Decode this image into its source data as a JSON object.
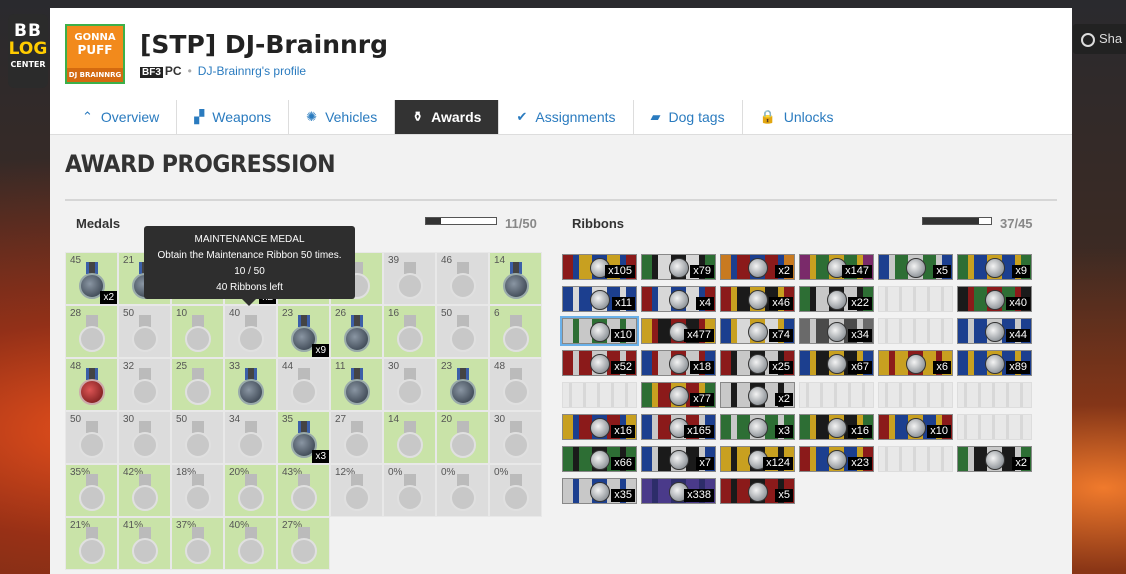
{
  "site_badge": {
    "line1": "BB",
    "line2": "LOG",
    "line3": "CENTER"
  },
  "share_label": "Sha",
  "profile": {
    "avatar": {
      "line1": "GONNA",
      "line2": "PUFF",
      "line3": "DJ BRAINNRG"
    },
    "name": "[STP] DJ-Brainnrg",
    "game_tag": "BF3",
    "platform": "PC",
    "profile_link": "DJ-Brainnrg's profile"
  },
  "tabs": [
    {
      "label": "Overview",
      "icon": "chevron-up-icon",
      "glyph": "⌃"
    },
    {
      "label": "Weapons",
      "icon": "gun-icon",
      "glyph": "▞"
    },
    {
      "label": "Vehicles",
      "icon": "gear-icon",
      "glyph": "✺"
    },
    {
      "label": "Awards",
      "icon": "medal-icon",
      "glyph": "⚱",
      "active": true
    },
    {
      "label": "Assignments",
      "icon": "check-icon",
      "glyph": "✔"
    },
    {
      "label": "Dog tags",
      "icon": "dogtag-icon",
      "glyph": "▰"
    },
    {
      "label": "Unlocks",
      "icon": "lock-icon",
      "glyph": "🔒"
    }
  ],
  "section_title": "AWARD PROGRESSION",
  "medals": {
    "label": "Medals",
    "count": "11/50",
    "progress": 0.22,
    "tooltip": {
      "title": "MAINTENANCE MEDAL",
      "desc": "Obtain the Maintenance Ribbon 50 times.",
      "progress": "10 / 50",
      "remaining": "40 Ribbons left"
    },
    "items": [
      {
        "num": "45",
        "done": true,
        "earned": true,
        "mult": "x2"
      },
      {
        "num": "21",
        "done": true,
        "earned": true
      },
      {
        "num": "",
        "done": true
      },
      {
        "num": "",
        "done": true,
        "earned": true,
        "mult": "x2"
      },
      {
        "num": "",
        "done": true
      },
      {
        "num": "",
        "done": true
      },
      {
        "num": "39",
        "done": false
      },
      {
        "num": "46",
        "done": false
      },
      {
        "num": "14",
        "done": true,
        "earned": true
      },
      {
        "num": "28",
        "done": true
      },
      {
        "num": "50",
        "done": false
      },
      {
        "num": "10",
        "done": true
      },
      {
        "num": "40",
        "done": false
      },
      {
        "num": "23",
        "done": true,
        "earned": true,
        "mult": "x9"
      },
      {
        "num": "26",
        "done": true,
        "earned": true
      },
      {
        "num": "16",
        "done": true
      },
      {
        "num": "50",
        "done": false
      },
      {
        "num": "6",
        "done": true
      },
      {
        "num": "48",
        "done": true,
        "earned": true,
        "red": true
      },
      {
        "num": "32",
        "done": false
      },
      {
        "num": "25",
        "done": true
      },
      {
        "num": "33",
        "done": true,
        "earned": true
      },
      {
        "num": "44",
        "done": false
      },
      {
        "num": "11",
        "done": true,
        "earned": true
      },
      {
        "num": "30",
        "done": false
      },
      {
        "num": "23",
        "done": true,
        "earned": true
      },
      {
        "num": "48",
        "done": false
      },
      {
        "num": "50",
        "done": false
      },
      {
        "num": "30",
        "done": false
      },
      {
        "num": "50",
        "done": false
      },
      {
        "num": "34",
        "done": false
      },
      {
        "num": "35",
        "done": true,
        "earned": true,
        "mult": "x3"
      },
      {
        "num": "27",
        "done": false
      },
      {
        "num": "14",
        "done": true
      },
      {
        "num": "20",
        "done": true
      },
      {
        "num": "30",
        "done": false
      },
      {
        "num": "35%",
        "done": true
      },
      {
        "num": "42%",
        "done": true
      },
      {
        "num": "18%",
        "done": false
      },
      {
        "num": "20%",
        "done": true
      },
      {
        "num": "43%",
        "done": true
      },
      {
        "num": "12%",
        "done": false
      },
      {
        "num": "0%",
        "done": false
      },
      {
        "num": "0%",
        "done": false
      },
      {
        "num": "0%",
        "done": false
      },
      {
        "num": "21%",
        "done": true
      },
      {
        "num": "41%",
        "done": true
      },
      {
        "num": "37%",
        "done": true
      },
      {
        "num": "40%",
        "done": true
      },
      {
        "num": "27%",
        "done": true
      }
    ]
  },
  "ribbons": {
    "label": "Ribbons",
    "count": "37/45",
    "progress": 0.82,
    "items": [
      {
        "mult": "x105",
        "colors": [
          "#8b1a1a",
          "#1c3f8f",
          "#c8a020"
        ]
      },
      {
        "mult": "x79",
        "colors": [
          "#2d6e34",
          "#1a1a1a",
          "#d8d8d8"
        ]
      },
      {
        "mult": "x2",
        "colors": [
          "#c87a20",
          "#1c3f8f",
          "#8b1a1a"
        ]
      },
      {
        "mult": "x147",
        "colors": [
          "#7a2a6a",
          "#c8a020",
          "#2d6e34"
        ]
      },
      {
        "mult": "x5",
        "colors": [
          "#1c3f8f",
          "#c8c8c8",
          "#2d6e34"
        ]
      },
      {
        "mult": "x9",
        "colors": [
          "#2d6e34",
          "#c8a020",
          "#1c3f8f"
        ]
      },
      {
        "mult": "x11",
        "colors": [
          "#1c3f8f",
          "#d8d8d8",
          "#1c3f8f"
        ]
      },
      {
        "mult": "x4",
        "colors": [
          "#8b1a1a",
          "#1c3f8f",
          "#d8d8d8"
        ]
      },
      {
        "mult": "x46",
        "colors": [
          "#8b1a1a",
          "#c8a020",
          "#1a1a1a"
        ]
      },
      {
        "mult": "x22",
        "colors": [
          "#2d6e34",
          "#1a1a1a",
          "#c8c8c8"
        ]
      },
      {
        "empty": true
      },
      {
        "mult": "x40",
        "colors": [
          "#1a1a1a",
          "#8b1a1a",
          "#2d6e34"
        ]
      },
      {
        "mult": "x10",
        "colors": [
          "#c8c8c8",
          "#2d6e34",
          "#c8c8c8"
        ],
        "sel": true
      },
      {
        "mult": "x477",
        "colors": [
          "#c8a020",
          "#8b1a1a",
          "#1a1a1a"
        ]
      },
      {
        "mult": "x74",
        "colors": [
          "#1c3f8f",
          "#c8a020",
          "#d8d8d8"
        ]
      },
      {
        "mult": "x34",
        "colors": [
          "#6a6a6a",
          "#c8c8c8",
          "#4a4a4a"
        ]
      },
      {
        "empty": true
      },
      {
        "mult": "x44",
        "colors": [
          "#1c3f8f",
          "#c8c8c8",
          "#1c3f8f"
        ]
      },
      {
        "mult": "x52",
        "colors": [
          "#8b1a1a",
          "#c8c8c8",
          "#8b1a1a"
        ]
      },
      {
        "mult": "x18",
        "colors": [
          "#1c3f8f",
          "#8b1a1a",
          "#c8c8c8"
        ]
      },
      {
        "mult": "x25",
        "colors": [
          "#8b1a1a",
          "#1a1a1a",
          "#c8c8c8"
        ]
      },
      {
        "mult": "x67",
        "colors": [
          "#1c3f8f",
          "#c8a020",
          "#1a1a1a"
        ]
      },
      {
        "mult": "x6",
        "colors": [
          "#c8a020",
          "#8b1a1a",
          "#c8a020"
        ]
      },
      {
        "mult": "x89",
        "colors": [
          "#1c3f8f",
          "#c8a020",
          "#1c3f8f"
        ]
      },
      {
        "empty": true
      },
      {
        "mult": "x77",
        "colors": [
          "#2d6e34",
          "#c8a020",
          "#8b1a1a"
        ]
      },
      {
        "mult": "x2",
        "colors": [
          "#c8c8c8",
          "#1a1a1a",
          "#c8c8c8"
        ]
      },
      {
        "empty": true
      },
      {
        "empty": true
      },
      {
        "empty": true
      },
      {
        "mult": "x16",
        "colors": [
          "#c8a020",
          "#1c3f8f",
          "#8b1a1a"
        ]
      },
      {
        "mult": "x165",
        "colors": [
          "#1c3f8f",
          "#c8c8c8",
          "#8b1a1a"
        ]
      },
      {
        "mult": "x3",
        "colors": [
          "#2d6e34",
          "#c8c8c8",
          "#2d6e34"
        ]
      },
      {
        "mult": "x16",
        "colors": [
          "#2d6e34",
          "#c8a020",
          "#1a1a1a"
        ]
      },
      {
        "mult": "x10",
        "colors": [
          "#8b1a1a",
          "#c8a020",
          "#1c3f8f"
        ]
      },
      {
        "empty": true
      },
      {
        "mult": "x66",
        "colors": [
          "#2d6e34",
          "#1a1a1a",
          "#2d6e34"
        ]
      },
      {
        "mult": "x7",
        "colors": [
          "#1c3f8f",
          "#c8c8c8",
          "#1a1a1a"
        ]
      },
      {
        "mult": "x124",
        "colors": [
          "#c8a020",
          "#1a1a1a",
          "#c8a020"
        ]
      },
      {
        "mult": "x23",
        "colors": [
          "#8b1a1a",
          "#c8a020",
          "#1c3f8f"
        ]
      },
      {
        "empty": true
      },
      {
        "mult": "x2",
        "colors": [
          "#2d6e34",
          "#c8c8c8",
          "#1a1a1a"
        ]
      },
      {
        "mult": "x35",
        "colors": [
          "#c8c8c8",
          "#1c3f8f",
          "#c8c8c8"
        ]
      },
      {
        "mult": "x338",
        "colors": [
          "#4a3a8a",
          "#2d2d6a",
          "#4a3a8a"
        ]
      },
      {
        "mult": "x5",
        "colors": [
          "#8b1a1a",
          "#1a1a1a",
          "#8b1a1a"
        ]
      }
    ]
  }
}
